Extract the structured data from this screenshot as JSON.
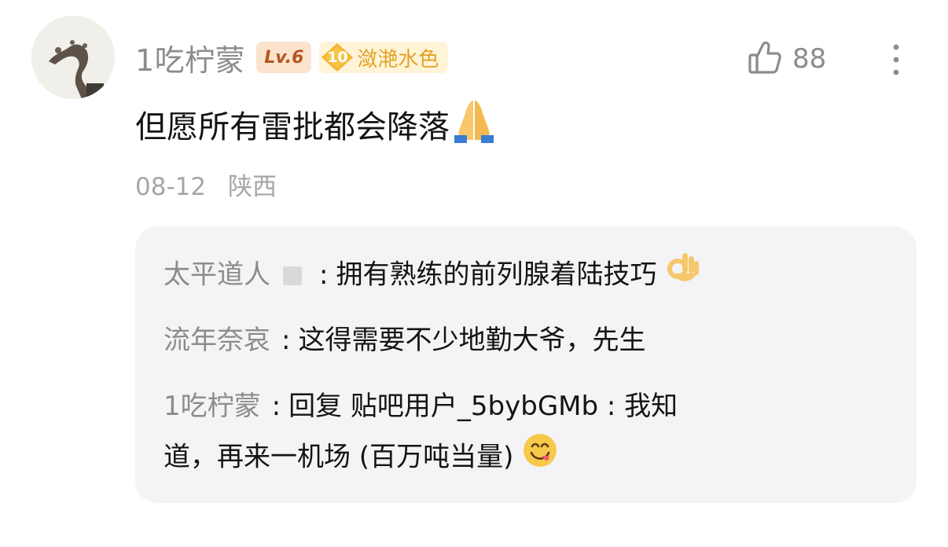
{
  "comment": {
    "username": "1吃柠蒙",
    "level": "Lv.6",
    "honor_level": "10",
    "honor_title": "潋滟水色",
    "like_count": "88",
    "content": "但愿所有雷批都会降落",
    "date": "08-12",
    "location": "陕西"
  },
  "replies": [
    {
      "author": "太平道人",
      "text": "拥有熟练的前列腺着陆技巧"
    },
    {
      "author": "流年奈哀",
      "text": "这得需要不少地勤大爷，先生"
    },
    {
      "author": "1吃柠蒙",
      "text_line1": "回复 贴吧用户_5bybGMb : 我知",
      "text_line2": "道，再来一机场 (百万吨当量)"
    }
  ],
  "colors": {
    "muted_text": "#8c8c8c",
    "level_bg": "#fbe3cd",
    "level_text": "#b5561f",
    "honor_bg": "#fff4d7",
    "honor_text": "#e2a326",
    "reply_bg": "#f4f4f6"
  },
  "icons": [
    "avatar",
    "honor-diamond-icon",
    "thumbs-up-icon",
    "more-vertical-icon",
    "folded-hands-emoji",
    "ok-hand-emoji",
    "yum-face-emoji"
  ]
}
